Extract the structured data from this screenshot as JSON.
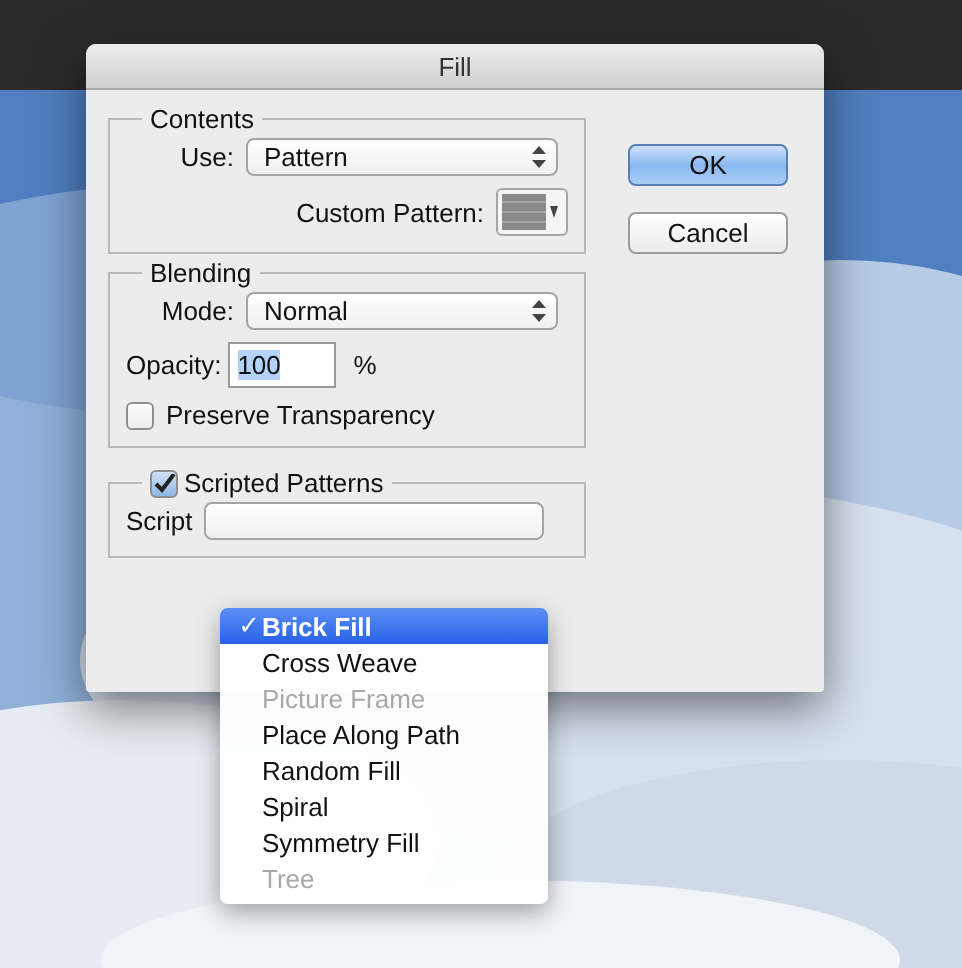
{
  "window": {
    "title": "Fill"
  },
  "contents": {
    "title": "Contents",
    "use_label": "Use:",
    "use_value": "Pattern",
    "custom_pattern_label": "Custom Pattern:"
  },
  "blending": {
    "title": "Blending",
    "mode_label": "Mode:",
    "mode_value": "Normal",
    "opacity_label": "Opacity:",
    "opacity_value": "100",
    "opacity_value_highlighted": true,
    "opacity_unit": "%",
    "preserve_transparency": {
      "label": "Preserve Transparency",
      "checked": false
    }
  },
  "scripted_patterns": {
    "label": "Scripted Patterns",
    "checked": true,
    "script_label": "Script"
  },
  "buttons": [
    {
      "label": "OK",
      "default": true
    },
    {
      "label": "Cancel",
      "default": false
    }
  ],
  "script_menu": {
    "check_mark": "✓",
    "items": [
      {
        "label": "Brick Fill",
        "selected": true,
        "disabled": false
      },
      {
        "label": "Cross Weave",
        "selected": false,
        "disabled": false
      },
      {
        "label": "Picture Frame",
        "selected": false,
        "disabled": true
      },
      {
        "label": "Place Along Path",
        "selected": false,
        "disabled": false
      },
      {
        "label": "Random Fill",
        "selected": false,
        "disabled": false
      },
      {
        "label": "Spiral",
        "selected": false,
        "disabled": false
      },
      {
        "label": "Symmetry Fill",
        "selected": false,
        "disabled": false
      },
      {
        "label": "Tree",
        "selected": false,
        "disabled": true
      }
    ]
  }
}
